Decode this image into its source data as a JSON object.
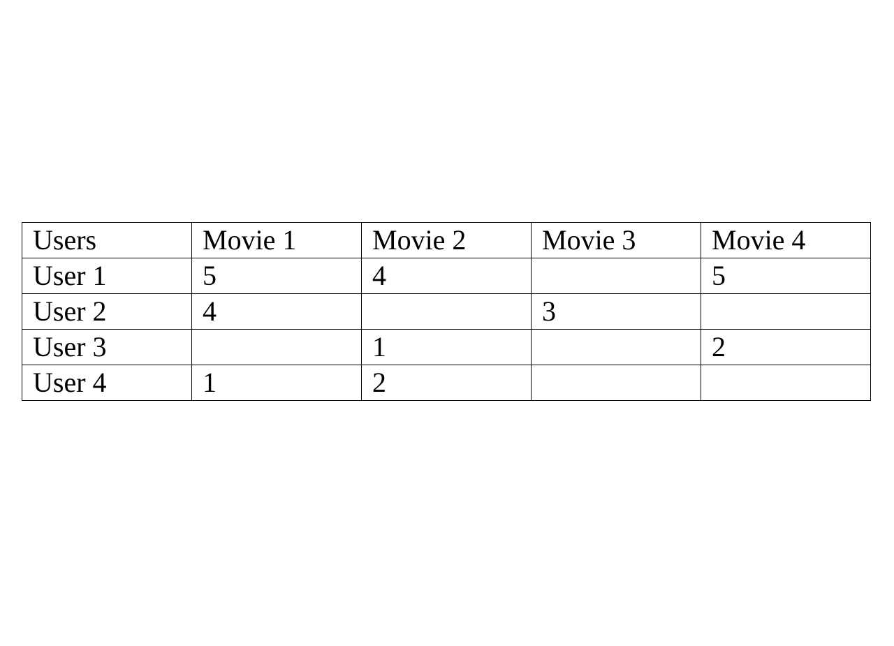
{
  "table": {
    "header": [
      "Users",
      "Movie 1",
      "Movie 2",
      "Movie 3",
      "Movie 4"
    ],
    "rows": [
      [
        "User 1",
        "5",
        "4",
        "",
        "5"
      ],
      [
        "User 2",
        "4",
        "",
        "3",
        ""
      ],
      [
        "User 3",
        "",
        "1",
        "",
        "2"
      ],
      [
        "User 4",
        "1",
        "2",
        "",
        ""
      ]
    ]
  }
}
